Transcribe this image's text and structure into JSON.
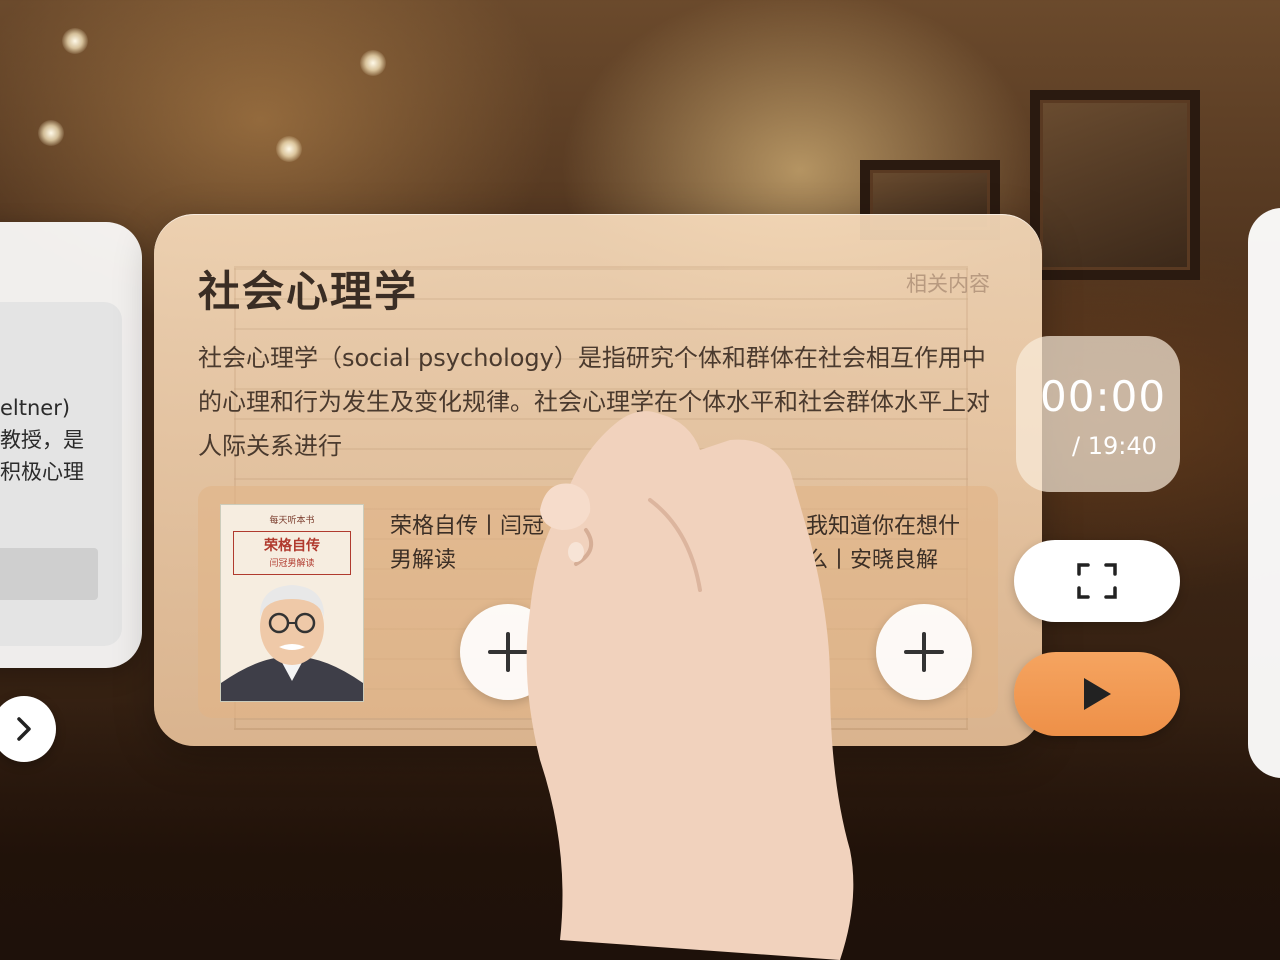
{
  "card": {
    "title": "社会心理学",
    "related_label": "相关内容",
    "description": "社会心理学（social psychology）是指研究个体和群体在社会相互作用中的心理和行为发生及变化规律。社会心理学在个体水平和社会群体水平上对人际关系进行",
    "recommendations": [
      {
        "cover_top": "每天听本书",
        "cover_title": "荣格自传",
        "cover_author": "闫冠男解读",
        "title": "荣格自传丨闫冠",
        "subtitle": "男解读"
      },
      {
        "title": "我知道你在想什",
        "subtitle": "么丨安晓良解"
      }
    ]
  },
  "left_panel": {
    "lines": [
      "eltner)",
      "教授，是",
      "积极心理"
    ]
  },
  "player": {
    "current_time": "00:00",
    "total_time": "/ 19:40"
  },
  "colors": {
    "card_bg": "#f3d6b4",
    "play_button": "#f09a52",
    "title_text": "#3a2d24"
  },
  "icons": {
    "next": "chevron-right-icon",
    "add": "plus-icon",
    "fullscreen": "fullscreen-icon",
    "play": "play-icon"
  }
}
